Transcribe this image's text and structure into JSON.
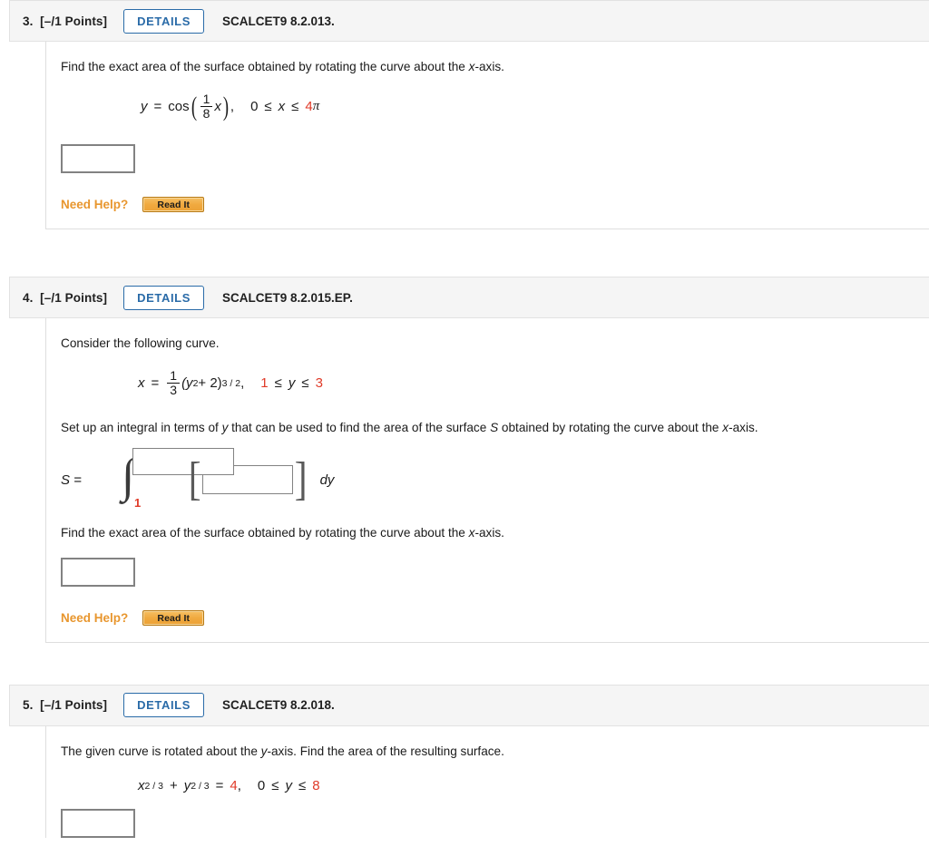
{
  "problems": [
    {
      "number": "3.",
      "points": "[–/1 Points]",
      "details_label": "DETAILS",
      "code": "SCALCET9 8.2.013.",
      "prompt": "Find the exact area of the surface obtained by rotating the curve about the x-axis.",
      "prompt_parts": {
        "a": "Find the exact area of the surface obtained by rotating the curve about the ",
        "italic": "x",
        "b": "-axis."
      },
      "equation": {
        "lhs": "y",
        "eq": "=",
        "fn": "cos",
        "frac_num": "1",
        "frac_den": "8",
        "arg_var": "x",
        "domain_lower": "0",
        "rel1": "≤",
        "domain_var": "x",
        "rel2": "≤",
        "domain_upper_num": "4",
        "domain_upper_sym": "π"
      },
      "answer_value": "",
      "need_help_label": "Need Help?",
      "read_it_label": "Read It"
    },
    {
      "number": "4.",
      "points": "[–/1 Points]",
      "details_label": "DETAILS",
      "code": "SCALCET9 8.2.015.EP.",
      "prompt": "Consider the following curve.",
      "equation": {
        "lhs": "x",
        "eq": "=",
        "frac_num": "1",
        "frac_den": "3",
        "base": "(y",
        "base_sup": "2",
        "base_mid": " + 2)",
        "exp": "3 / 2",
        "comma": ",",
        "domain_lower": "1",
        "rel1": "≤",
        "domain_var": "y",
        "rel2": "≤",
        "domain_upper": "3"
      },
      "setup_prompt_parts": {
        "a": "Set up an integral in terms of ",
        "italic1": "y",
        "b": " that can be used to find the area of the surface ",
        "italic2": "S",
        "c": " obtained by rotating the curve about the ",
        "italic3": "x",
        "d": "-axis."
      },
      "integral": {
        "s_label": "S  =",
        "upper_limit_value": "",
        "lower_limit_value": "1",
        "integrand_value": "",
        "differential": "dy",
        "bracket_left": "[",
        "bracket_right": "]"
      },
      "prompt2_parts": {
        "a": "Find the exact area of the surface obtained by rotating the curve about the ",
        "italic": "x",
        "b": "-axis."
      },
      "answer_value": "",
      "need_help_label": "Need Help?",
      "read_it_label": "Read It"
    },
    {
      "number": "5.",
      "points": "[–/1 Points]",
      "details_label": "DETAILS",
      "code": "SCALCET9 8.2.018.",
      "prompt_parts": {
        "a": "The given curve is rotated about the ",
        "italic": "y",
        "b": "-axis. Find the area of the resulting surface."
      },
      "equation": {
        "x_base": "x",
        "x_exp": "2 / 3",
        "plus": "+",
        "y_base": "y",
        "y_exp": "2 / 3",
        "eq": "=",
        "rhs": "4",
        "comma": ",",
        "domain_lower": "0",
        "rel1": "≤",
        "domain_var": "y",
        "rel2": "≤",
        "domain_upper": "8"
      },
      "answer_value": ""
    }
  ],
  "colors": {
    "accent_blue": "#2a6ba8",
    "accent_red": "#e03a28",
    "accent_orange": "#e8962e",
    "button_gold": "#f0a93f",
    "header_bg": "#f5f5f5"
  }
}
